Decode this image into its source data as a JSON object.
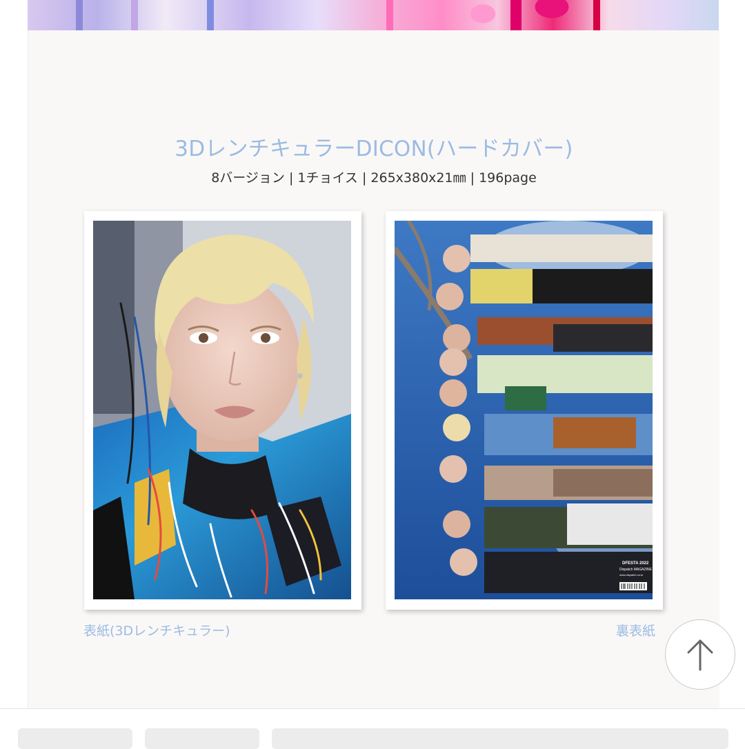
{
  "product": {
    "title": "3DレンチキュラーDICON(ハードカバー)",
    "specs": "8バージョン | 1チョイス | 265x380x21㎜ | 196page"
  },
  "images": {
    "front_caption": "表紙(3Dレンチキュラー)",
    "back_caption": "裏表紙",
    "back_cover_text": {
      "logo": "DFESTA 2022",
      "magazine": "Dispatch MAGAZINE",
      "url": "www.dispatch.co.kr"
    }
  },
  "icons": {
    "scroll_top": "arrow-up-icon"
  },
  "colors": {
    "accent": "#9bbbe3",
    "panel_background": "#faf8f7",
    "spec_text": "#333333"
  }
}
